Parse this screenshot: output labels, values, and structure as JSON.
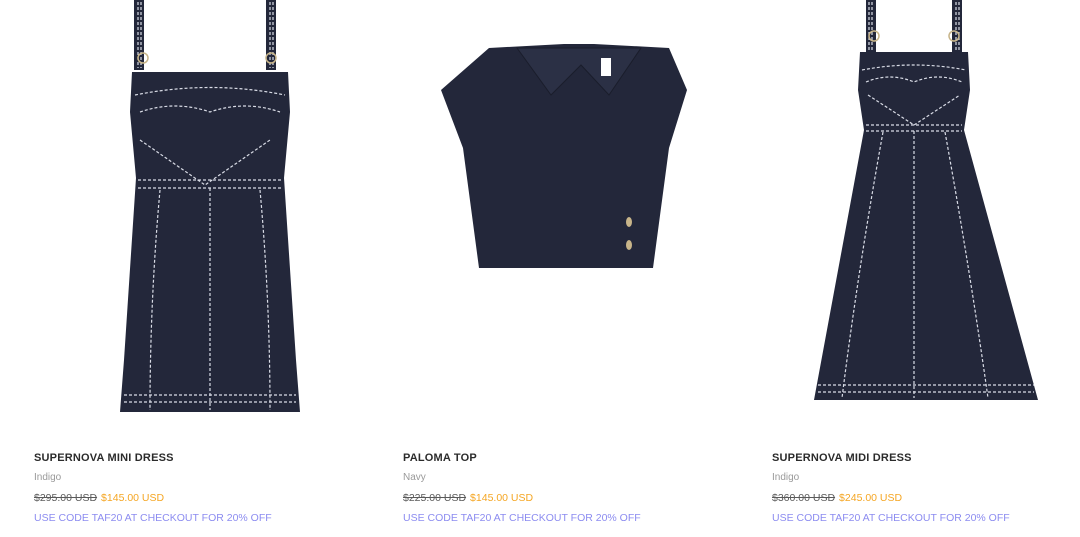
{
  "products": [
    {
      "name": "SUPERNOVA MINI DRESS",
      "color": "Indigo",
      "price_original": "$295.00 USD",
      "price_sale": "$145.00 USD",
      "promo": "USE CODE TAF20 AT CHECKOUT FOR 20% OFF",
      "image_icon": "mini-dress-image"
    },
    {
      "name": "PALOMA TOP",
      "color": "Navy",
      "price_original": "$225.00 USD",
      "price_sale": "$145.00 USD",
      "promo": "USE CODE TAF20 AT CHECKOUT FOR 20% OFF",
      "image_icon": "top-image"
    },
    {
      "name": "SUPERNOVA MIDI DRESS",
      "color": "Indigo",
      "price_original": "$360.00 USD",
      "price_sale": "$245.00 USD",
      "promo": "USE CODE TAF20 AT CHECKOUT FOR 20% OFF",
      "image_icon": "midi-dress-image"
    }
  ],
  "colors": {
    "garment": "#23273a",
    "stitch": "#d9dce6",
    "sale": "#f5a623",
    "promo": "#8c8cf0"
  }
}
